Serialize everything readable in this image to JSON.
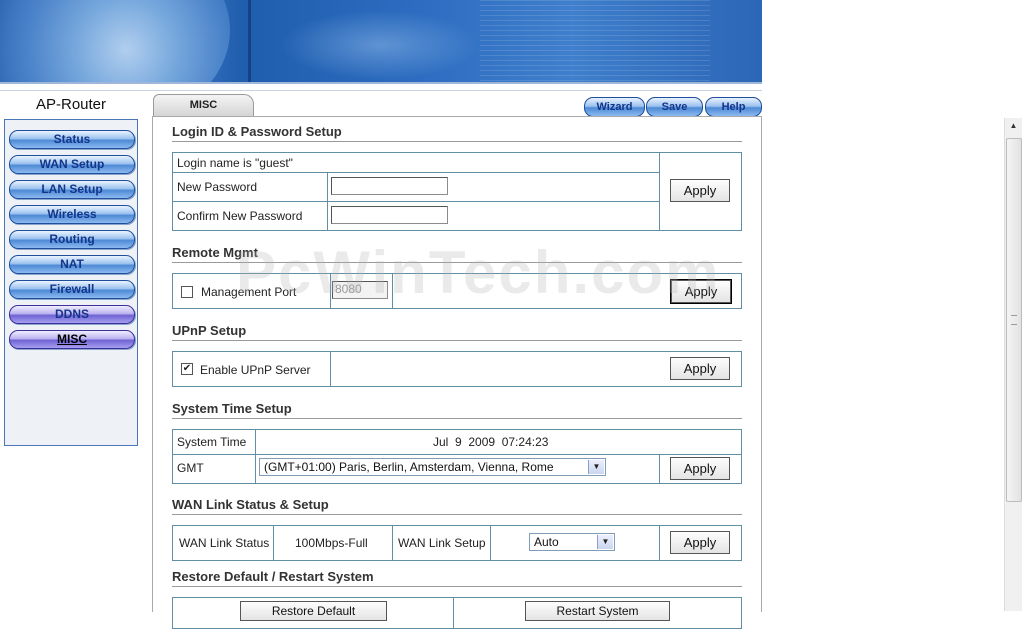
{
  "brand": "AP-Router",
  "sidebar": {
    "items": [
      {
        "label": "Status"
      },
      {
        "label": "WAN Setup"
      },
      {
        "label": "LAN Setup"
      },
      {
        "label": "Wireless"
      },
      {
        "label": "Routing"
      },
      {
        "label": "NAT"
      },
      {
        "label": "Firewall"
      },
      {
        "label": "DDNS"
      },
      {
        "label": "MISC"
      }
    ]
  },
  "tab": {
    "label": "MISC"
  },
  "toolbar": {
    "wizard": "Wizard",
    "save": "Save",
    "help": "Help"
  },
  "watermark": "PcWinTech.com",
  "login": {
    "title": "Login ID & Password Setup",
    "login_name": "Login name is \"guest\"",
    "new_password_label": "New Password",
    "confirm_password_label": "Confirm New Password",
    "new_password_value": "",
    "confirm_password_value": "",
    "apply": "Apply"
  },
  "remote": {
    "title": "Remote Mgmt",
    "checkbox_label": "Management Port",
    "checked": false,
    "port_value": "8080",
    "apply": "Apply"
  },
  "upnp": {
    "title": "UPnP Setup",
    "checkbox_label": "Enable UPnP Server",
    "checked": true,
    "apply": "Apply"
  },
  "time": {
    "title": "System Time Setup",
    "system_time_label": "System Time",
    "system_time_value": "Jul  9  2009  07:24:23",
    "gmt_label": "GMT",
    "gmt_value": "(GMT+01:00) Paris, Berlin, Amsterdam, Vienna, Rome",
    "apply": "Apply"
  },
  "wan": {
    "title": "WAN Link Status & Setup",
    "status_label": "WAN Link Status",
    "status_value": "100Mbps-Full",
    "setup_label": "WAN Link Setup",
    "setup_value": "Auto",
    "apply": "Apply"
  },
  "restore": {
    "title": "Restore Default / Restart System",
    "restore_btn": "Restore Default",
    "restart_btn": "Restart System"
  }
}
